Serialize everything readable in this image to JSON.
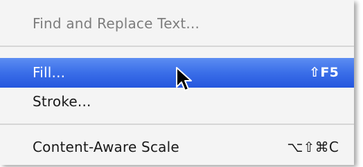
{
  "menu": {
    "items": [
      {
        "label": "Find and Replace Text...",
        "shortcut": "",
        "enabled": false,
        "highlighted": false
      },
      {
        "label": "Fill...",
        "shortcut": "⇧F5",
        "enabled": true,
        "highlighted": true
      },
      {
        "label": "Stroke...",
        "shortcut": "",
        "enabled": true,
        "highlighted": false
      },
      {
        "label": "Content-Aware Scale",
        "shortcut": "⌥⇧⌘C",
        "enabled": true,
        "highlighted": false
      }
    ]
  },
  "cursor": {
    "icon": "arrow-pointer-icon"
  },
  "colors": {
    "highlight": "#3a6ee8",
    "menu_background": "#f4f4f4",
    "disabled_text": "#7d7d7d"
  }
}
